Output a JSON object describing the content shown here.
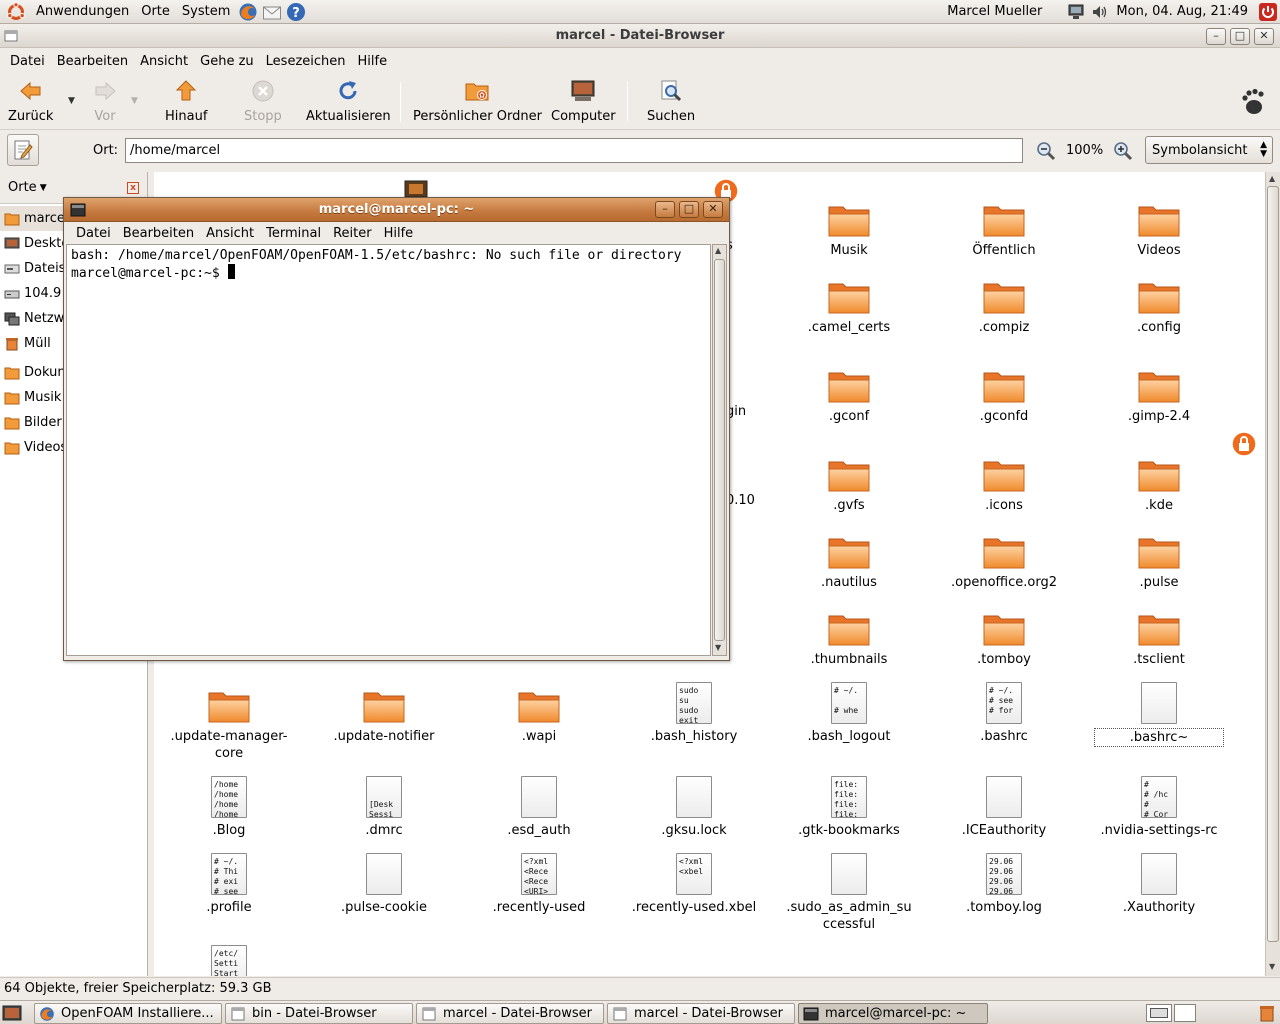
{
  "top_panel": {
    "menus": [
      "Anwendungen",
      "Orte",
      "System"
    ],
    "user": "Marcel Mueller",
    "clock": "Mon, 04. Aug, 21:49"
  },
  "nautilus": {
    "title": "marcel - Datei-Browser",
    "menu": [
      "Datei",
      "Bearbeiten",
      "Ansicht",
      "Gehe zu",
      "Lesezeichen",
      "Hilfe"
    ],
    "toolbar": {
      "back": "Zurück",
      "forward": "Vor",
      "up": "Hinauf",
      "stop": "Stopp",
      "reload": "Aktualisieren",
      "home": "Persönlicher Ordner",
      "computer": "Computer",
      "search": "Suchen"
    },
    "location_label": "Ort:",
    "location_value": "/home/marcel",
    "zoom": "100%",
    "view_mode": "Symbolansicht",
    "sidebar": {
      "header": "Orte",
      "items": [
        "marcel",
        "Desktop",
        "Dateisystem",
        "104.9",
        "Netzwerk",
        "Müll",
        "Dokumente",
        "Musik",
        "Bilder",
        "Videos"
      ]
    },
    "partial_labels": [
      "s",
      "gin",
      "0.10"
    ],
    "files": [
      {
        "name": "Musik",
        "type": "folder"
      },
      {
        "name": "Öffentlich",
        "type": "folder"
      },
      {
        "name": "Videos",
        "type": "folder"
      },
      {
        "name": ".camel_certs",
        "type": "folder"
      },
      {
        "name": ".compiz",
        "type": "folder"
      },
      {
        "name": ".config",
        "type": "folder"
      },
      {
        "name": ".gconf",
        "type": "folder"
      },
      {
        "name": ".gconfd",
        "type": "folder"
      },
      {
        "name": ".gimp-2.4",
        "type": "folder"
      },
      {
        "name": ".gvfs",
        "type": "folder"
      },
      {
        "name": ".icons",
        "type": "folder"
      },
      {
        "name": ".kde",
        "type": "folder-locked"
      },
      {
        "name": ".nautilus",
        "type": "folder"
      },
      {
        "name": ".openoffice.org2",
        "type": "folder"
      },
      {
        "name": ".pulse",
        "type": "folder"
      },
      {
        "name": ".thumbnails",
        "type": "folder"
      },
      {
        "name": ".tomboy",
        "type": "folder"
      },
      {
        "name": ".tsclient",
        "type": "folder"
      },
      {
        "name": ".update-manager-core",
        "type": "folder"
      },
      {
        "name": ".update-notifier",
        "type": "folder"
      },
      {
        "name": ".wapi",
        "type": "folder"
      },
      {
        "name": ".bash_history",
        "type": "text",
        "preview": "sudo\nsu\nsudo\nexit"
      },
      {
        "name": ".bash_logout",
        "type": "text",
        "preview": "# ~/.\n\n# whe"
      },
      {
        "name": ".bashrc",
        "type": "text",
        "preview": "# ~/.\n# see\n# for"
      },
      {
        "name": ".bashrc~",
        "type": "text",
        "preview": ""
      },
      {
        "name": ".Blog",
        "type": "text",
        "preview": "/home\n/home\n/home\n/home"
      },
      {
        "name": ".dmrc",
        "type": "text",
        "preview": "\n\n[Desk\nSessi"
      },
      {
        "name": ".esd_auth",
        "type": "text",
        "preview": ""
      },
      {
        "name": ".gksu.lock",
        "type": "text",
        "preview": ""
      },
      {
        "name": ".gtk-bookmarks",
        "type": "text",
        "preview": "file:\nfile:\nfile:\nfile:"
      },
      {
        "name": ".ICEauthority",
        "type": "text",
        "preview": ""
      },
      {
        "name": ".nvidia-settings-rc",
        "type": "text",
        "preview": "#\n# /hc\n#\n# Cor"
      },
      {
        "name": ".profile",
        "type": "text",
        "preview": "# ~/.\n# Thi\n# exi\n# see"
      },
      {
        "name": ".pulse-cookie",
        "type": "text",
        "preview": ""
      },
      {
        "name": ".recently-used",
        "type": "text",
        "preview": "<?xml\n<Rece\n<Rece\n<URI>"
      },
      {
        "name": ".recently-used.xbel",
        "type": "text",
        "preview": "<?xml\n<xbel"
      },
      {
        "name": ".sudo_as_admin_successful",
        "type": "text",
        "preview": ""
      },
      {
        "name": ".tomboy.log",
        "type": "text",
        "preview": "29.06\n29.06\n29.06\n29.06"
      },
      {
        "name": ".Xauthority",
        "type": "text",
        "preview": ""
      },
      {
        "name": "",
        "type": "text",
        "preview": "/etc/\nSetti\nStart"
      }
    ],
    "status": "64 Objekte, freier Speicherplatz: 59.3 GB"
  },
  "terminal": {
    "title": "marcel@marcel-pc: ~",
    "menu": [
      "Datei",
      "Bearbeiten",
      "Ansicht",
      "Terminal",
      "Reiter",
      "Hilfe"
    ],
    "lines": [
      "bash: /home/marcel/OpenFOAM/OpenFOAM-1.5/etc/bashrc: No such file or directory",
      "marcel@marcel-pc:~$ "
    ]
  },
  "taskbar": [
    {
      "label": "OpenFOAM Installiere...",
      "icon": "firefox-icon"
    },
    {
      "label": "bin - Datei-Browser",
      "icon": "file-browser-icon"
    },
    {
      "label": "marcel - Datei-Browser",
      "icon": "file-browser-icon"
    },
    {
      "label": "marcel - Datei-Browser",
      "icon": "file-browser-icon"
    },
    {
      "label": "marcel@marcel-pc: ~",
      "icon": "terminal-icon",
      "active": true
    }
  ],
  "colors": {
    "folder": "#f08a2c",
    "terminal_title": "#c5793e",
    "accent": "#d94f1e"
  }
}
